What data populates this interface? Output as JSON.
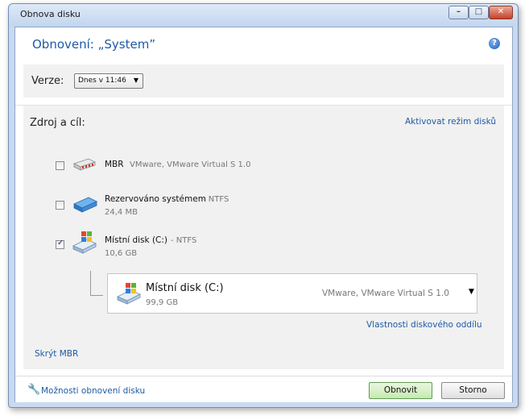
{
  "window": {
    "title": "Obnova disku",
    "heading": "Obnovení: „System”",
    "controls": {
      "minimize": "–",
      "maximize": "□",
      "close": "✕"
    }
  },
  "help_icon": "question-mark-icon",
  "version": {
    "label": "Verze:",
    "selected": "Dnes v 11:46"
  },
  "source_target": {
    "title": "Zdroj a cíl:",
    "activate_link": "Aktivovat režim disků",
    "items": [
      {
        "name": "MBR",
        "detail": "VMware, VMware Virtual S 1.0",
        "size": "",
        "checked": false,
        "icon": "mbr-disk-icon"
      },
      {
        "name": "Rezervováno systémem",
        "detail": " - NTFS",
        "size": "24,4 MB",
        "checked": false,
        "icon": "partition-icon"
      },
      {
        "name": "Místní disk (C:)",
        "detail": " - NTFS",
        "size": "10,6 GB",
        "checked": true,
        "icon": "windows-partition-icon"
      }
    ],
    "target": {
      "name": "Místní disk (C:)",
      "size": "99,9 GB",
      "description": "VMware, VMware Virtual S 1.0"
    },
    "properties_link": "Vlastnosti diskového oddílu",
    "hide_mbr_link": "Skrýt MBR"
  },
  "footer": {
    "options_link": "Možnosti obnovení disku",
    "restore_button": "Obnovit",
    "cancel_button": "Storno"
  },
  "colors": {
    "accent_link": "#1f5aa6",
    "ok_button": "#c5e9b0"
  }
}
